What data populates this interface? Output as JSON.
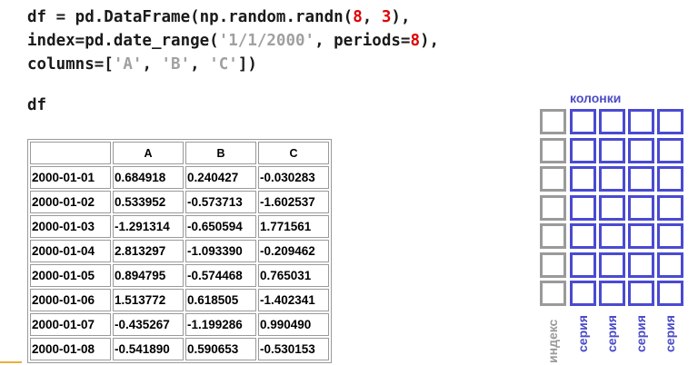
{
  "code": {
    "lines": [
      [
        {
          "t": "df = pd.DataFrame(np.random.randn(",
          "c": "plain"
        },
        {
          "t": "8",
          "c": "num"
        },
        {
          "t": ", ",
          "c": "plain"
        },
        {
          "t": "3",
          "c": "num"
        },
        {
          "t": "),",
          "c": "plain"
        }
      ],
      [
        {
          "t": "index=pd.date_range(",
          "c": "plain"
        },
        {
          "t": "'1/1/2000'",
          "c": "str"
        },
        {
          "t": ", periods=",
          "c": "plain"
        },
        {
          "t": "8",
          "c": "num"
        },
        {
          "t": "),",
          "c": "plain"
        }
      ],
      [
        {
          "t": "columns=[",
          "c": "plain"
        },
        {
          "t": "'A'",
          "c": "str"
        },
        {
          "t": ", ",
          "c": "plain"
        },
        {
          "t": "'B'",
          "c": "str"
        },
        {
          "t": ", ",
          "c": "plain"
        },
        {
          "t": "'C'",
          "c": "str"
        },
        {
          "t": "])",
          "c": "plain"
        }
      ]
    ]
  },
  "df_label": "df",
  "table": {
    "columns": [
      "A",
      "B",
      "C"
    ],
    "rows": [
      {
        "index": "2000-01-01",
        "values": [
          "0.684918",
          "0.240427",
          "-0.030283"
        ]
      },
      {
        "index": "2000-01-02",
        "values": [
          "0.533952",
          "-0.573713",
          "-1.602537"
        ]
      },
      {
        "index": "2000-01-03",
        "values": [
          "-1.291314",
          "-0.650594",
          "1.771561"
        ]
      },
      {
        "index": "2000-01-04",
        "values": [
          "2.813297",
          "-1.093390",
          "-0.209462"
        ]
      },
      {
        "index": "2000-01-05",
        "values": [
          "0.894795",
          "-0.574468",
          "0.765031"
        ]
      },
      {
        "index": "2000-01-06",
        "values": [
          "1.513772",
          "0.618505",
          "-1.402341"
        ]
      },
      {
        "index": "2000-01-07",
        "values": [
          "-0.435267",
          "-1.199286",
          "0.990490"
        ]
      },
      {
        "index": "2000-01-08",
        "values": [
          "-0.541890",
          "0.590653",
          "-0.530153"
        ]
      }
    ]
  },
  "schema": {
    "title": "колонки",
    "index_label": "индекс",
    "series_label": "серия",
    "series_count": 4,
    "cell_rows": 7,
    "colors": {
      "index": "#9a9a9a",
      "series": "#4a4ad2"
    }
  },
  "colors": {
    "code_number": "#e00000",
    "code_string": "#a0a0a0",
    "accent_line": "#e9b13a"
  }
}
